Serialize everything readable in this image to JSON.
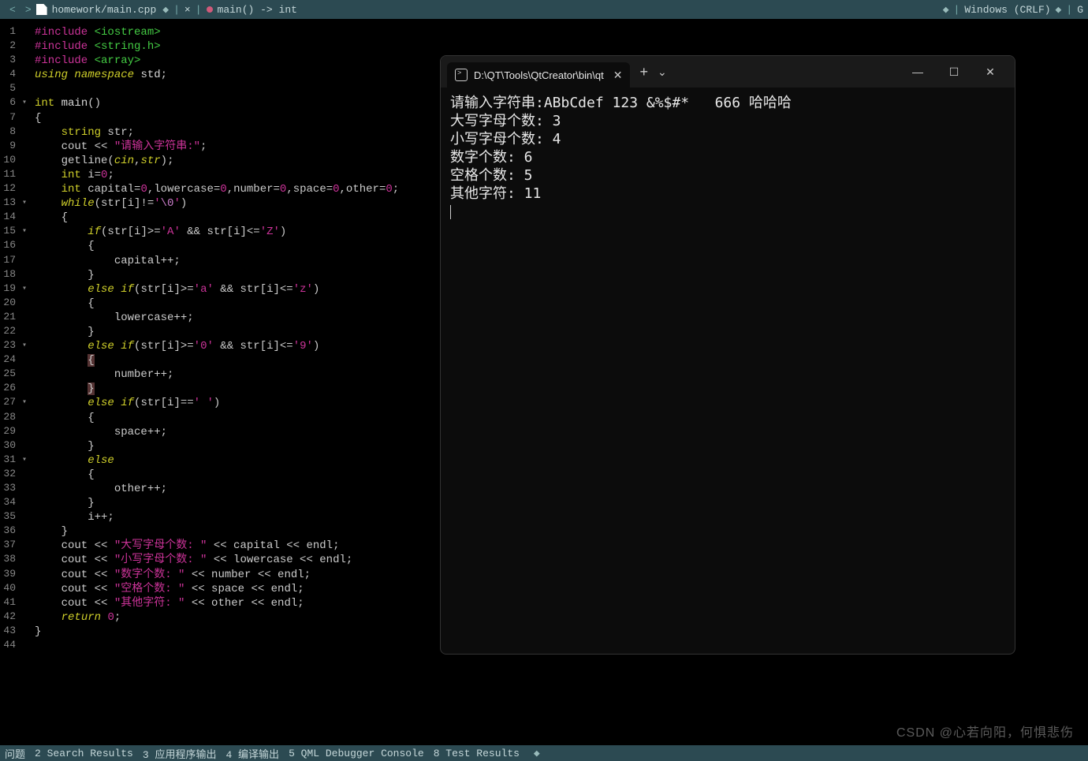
{
  "topbar": {
    "file_path": "homework/main.cpp",
    "close_x": "×",
    "function_sig": "main() -> int",
    "line_ending": "Windows (CRLF)",
    "lang_hint": "G"
  },
  "terminal": {
    "tab_title": "D:\\QT\\Tools\\QtCreator\\bin\\qt",
    "lines": [
      "请输入字符串:ABbCdef 123 &%$#*   666 哈哈哈",
      "大写字母个数: 3",
      "小写字母个数: 4",
      "数字个数: 6",
      "空格个数: 5",
      "其他字符: 11"
    ]
  },
  "bottombar": {
    "items": [
      "问题",
      "2 Search Results",
      "3 应用程序输出",
      "4 编译输出",
      "5 QML Debugger Console",
      "8 Test Results"
    ]
  },
  "watermark": "CSDN @心若向阳，何惧悲伤",
  "code": {
    "lines": [
      {
        "n": 1,
        "html": "<span class='inc'>#include</span> <span class='hdr'>&lt;iostream&gt;</span>"
      },
      {
        "n": 2,
        "html": "<span class='inc'>#include</span> <span class='hdr'>&lt;string.h&gt;</span>"
      },
      {
        "n": 3,
        "html": "<span class='inc'>#include</span> <span class='hdr'>&lt;array&gt;</span>"
      },
      {
        "n": 4,
        "html": "<span class='kw'>using</span> <span class='kw'>namespace</span> <span class='id'>std</span>;"
      },
      {
        "n": 5,
        "html": ""
      },
      {
        "n": 6,
        "fold": "▾",
        "html": "<span class='type'>int</span> <span class='id'>main</span>()"
      },
      {
        "n": 7,
        "html": "{"
      },
      {
        "n": 8,
        "html": "    <span class='type'>string</span> str;"
      },
      {
        "n": 9,
        "html": "    cout &lt;&lt; <span class='str'>\"请输入字符串:\"</span>;"
      },
      {
        "n": 10,
        "html": "    getline(<span class='kw'>cin</span>,<span class='kw'>str</span>);"
      },
      {
        "n": 11,
        "html": "    <span class='type'>int</span> i=<span class='num'>0</span>;"
      },
      {
        "n": 12,
        "html": "    <span class='type'>int</span> capital=<span class='num'>0</span>,lowercase=<span class='num'>0</span>,number=<span class='num'>0</span>,space=<span class='num'>0</span>,other=<span class='num'>0</span>;"
      },
      {
        "n": 13,
        "fold": "▾",
        "html": "    <span class='kw'>while</span>(str[i]!=<span class='str'>'<span class='esc'>\\0</span>'</span>)"
      },
      {
        "n": 14,
        "html": "    {"
      },
      {
        "n": 15,
        "fold": "▾",
        "html": "        <span class='kw'>if</span>(str[i]&gt;=<span class='str'>'A'</span> &amp;&amp; str[i]&lt;=<span class='str'>'Z'</span>)"
      },
      {
        "n": 16,
        "html": "        {"
      },
      {
        "n": 17,
        "html": "            capital++;"
      },
      {
        "n": 18,
        "html": "        }"
      },
      {
        "n": 19,
        "fold": "▾",
        "html": "        <span class='kw'>else</span> <span class='kw'>if</span>(str[i]&gt;=<span class='str'>'a'</span> &amp;&amp; str[i]&lt;=<span class='str'>'z'</span>)"
      },
      {
        "n": 20,
        "html": "        {"
      },
      {
        "n": 21,
        "html": "            lowercase++;"
      },
      {
        "n": 22,
        "html": "        }"
      },
      {
        "n": 23,
        "fold": "▾",
        "html": "        <span class='kw'>else</span> <span class='kw'>if</span>(str[i]&gt;=<span class='str'>'0'</span> &amp;&amp; str[i]&lt;=<span class='str'>'9'</span>)"
      },
      {
        "n": 24,
        "html": "        <span class='hl'>{</span>"
      },
      {
        "n": 25,
        "html": "            number++;"
      },
      {
        "n": 26,
        "html": "        <span class='hl'>}</span>"
      },
      {
        "n": 27,
        "fold": "▾",
        "html": "        <span class='kw'>else</span> <span class='kw'>if</span>(str[i]==<span class='str'>' '</span>)"
      },
      {
        "n": 28,
        "html": "        {"
      },
      {
        "n": 29,
        "html": "            space++;"
      },
      {
        "n": 30,
        "html": "        }"
      },
      {
        "n": 31,
        "fold": "▾",
        "html": "        <span class='kw'>else</span>"
      },
      {
        "n": 32,
        "html": "        {"
      },
      {
        "n": 33,
        "html": "            other++;"
      },
      {
        "n": 34,
        "html": "        }"
      },
      {
        "n": 35,
        "html": "        i++;"
      },
      {
        "n": 36,
        "html": "    }"
      },
      {
        "n": 37,
        "html": "    cout &lt;&lt; <span class='str'>\"大写字母个数: \"</span> &lt;&lt; capital &lt;&lt; endl;"
      },
      {
        "n": 38,
        "html": "    cout &lt;&lt; <span class='str'>\"小写字母个数: \"</span> &lt;&lt; lowercase &lt;&lt; endl;"
      },
      {
        "n": 39,
        "html": "    cout &lt;&lt; <span class='str'>\"数字个数: \"</span> &lt;&lt; number &lt;&lt; endl;"
      },
      {
        "n": 40,
        "html": "    cout &lt;&lt; <span class='str'>\"空格个数: \"</span> &lt;&lt; space &lt;&lt; endl;"
      },
      {
        "n": 41,
        "html": "    cout &lt;&lt; <span class='str'>\"其他字符: \"</span> &lt;&lt; other &lt;&lt; endl;"
      },
      {
        "n": 42,
        "html": "    <span class='kw'>return</span> <span class='num'>0</span>;"
      },
      {
        "n": 43,
        "html": "}"
      },
      {
        "n": 44,
        "html": ""
      }
    ]
  }
}
